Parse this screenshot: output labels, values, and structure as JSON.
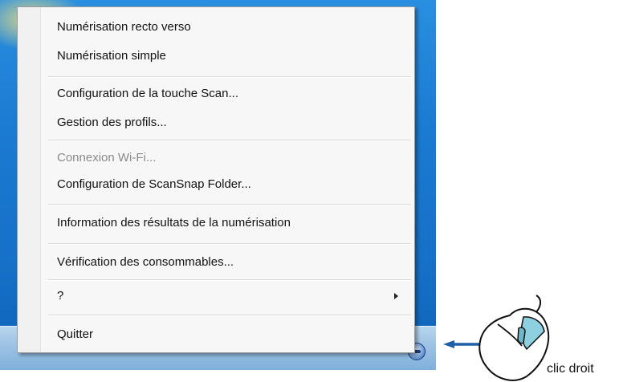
{
  "menu": {
    "items": [
      {
        "label": "Numérisation recto verso",
        "enabled": true
      },
      {
        "label": "Numérisation simple",
        "enabled": true
      },
      {
        "label": "Configuration de la touche Scan...",
        "enabled": true
      },
      {
        "label": "Gestion des profils...",
        "enabled": true
      },
      {
        "label": "Connexion Wi-Fi...",
        "enabled": false
      },
      {
        "label": "Configuration de ScanSnap Folder...",
        "enabled": true
      },
      {
        "label": "Information des résultats de la numérisation",
        "enabled": true
      },
      {
        "label": "Vérification des consommables...",
        "enabled": true
      },
      {
        "label": "?",
        "enabled": true,
        "has_submenu": true
      },
      {
        "label": "Quitter",
        "enabled": true
      }
    ]
  },
  "taskbar": {
    "tray_icon": "scansnap-manager-icon"
  },
  "illustration": {
    "arrow_color": "#1f5ea8",
    "mouse_button_highlight": "#8fd0e0",
    "caption": "clic droit"
  }
}
